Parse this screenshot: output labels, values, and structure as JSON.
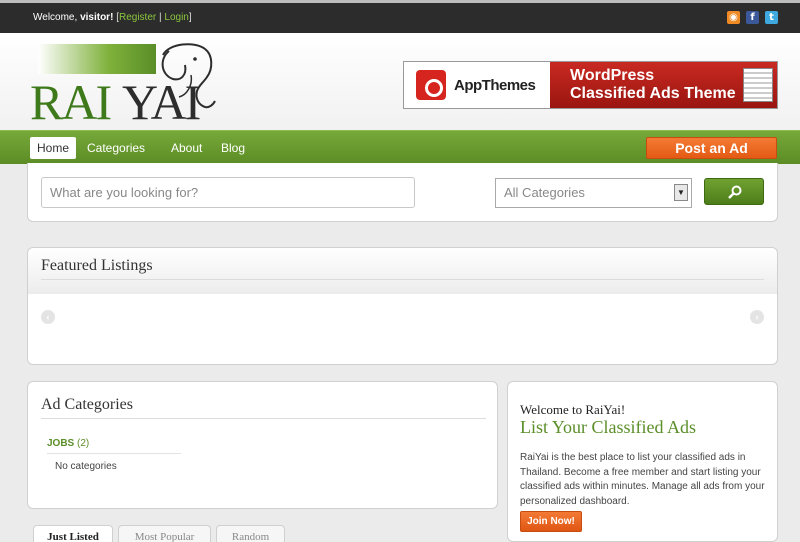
{
  "topbar": {
    "welcome_prefix": "Welcome,",
    "user": "visitor!",
    "bracket_open": "[",
    "register": "Register",
    "separator": "|",
    "login": "Login",
    "bracket_close": "]",
    "social": {
      "rss": "rss-icon",
      "facebook": "facebook-icon",
      "twitter": "twitter-icon"
    }
  },
  "logo": {
    "rai": "RAI",
    "yai": "YAI"
  },
  "banner": {
    "brand": "AppThemes",
    "line1": "WordPress",
    "line2": "Classified Ads Theme"
  },
  "nav": {
    "items": [
      {
        "label": "Home",
        "active": true
      },
      {
        "label": "Categories",
        "active": false
      },
      {
        "label": "About",
        "active": false
      },
      {
        "label": "Blog",
        "active": false
      }
    ],
    "post_ad": "Post an Ad"
  },
  "search": {
    "placeholder": "What are you looking for?",
    "category": "All Categories"
  },
  "featured": {
    "title": "Featured Listings"
  },
  "categories": {
    "title": "Ad Categories",
    "items": [
      {
        "label": "JOBS",
        "count": "(2)"
      }
    ],
    "empty": "No categories"
  },
  "welcome_box": {
    "small": "Welcome to RaiYai!",
    "big": "List Your Classified Ads",
    "text": "RaiYai is the best place to list your classified ads in Thailand. Become a free member and start listing your classified ads within minutes. Manage all ads from your personalized dashboard.",
    "button": "Join Now!"
  },
  "tabs": [
    {
      "label": "Just Listed",
      "active": true
    },
    {
      "label": "Most Popular",
      "active": false
    },
    {
      "label": "Random",
      "active": false
    }
  ],
  "colors": {
    "accent": "#5a8e28",
    "orange": "#e35a14",
    "topbar": "#2c2c2c"
  }
}
